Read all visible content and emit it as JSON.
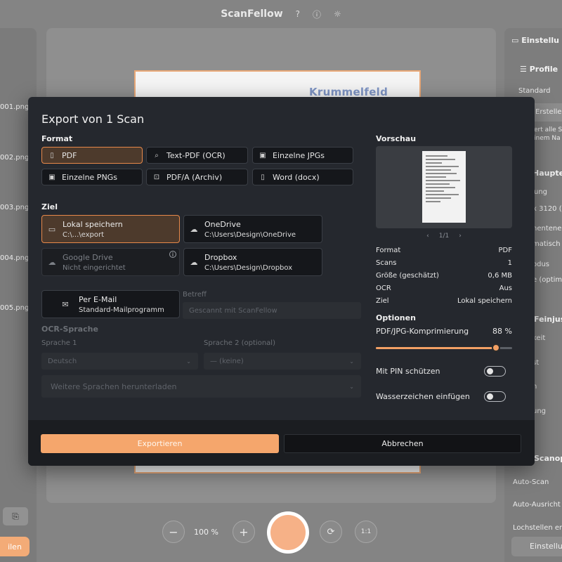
{
  "app": {
    "title": "ScanFellow",
    "files": [
      "001.png",
      "002.png",
      "003.png",
      "004.png",
      "005.png"
    ],
    "left_button_label": "ilen",
    "scan_brand": "Krummelfeld",
    "zoom": "100 %",
    "ratio_label": "1:1"
  },
  "settings_panel": {
    "title": "Einstellu",
    "profile_label": "Profile",
    "profile_value": "Standard",
    "create_label": "Erstelle",
    "desc_line1": "ert alle Sc",
    "desc_line2": "inem Na",
    "section1": "Hauptei",
    "item1": "ung",
    "resolution": "x 3120 (",
    "item3": "nentene",
    "item4": "matisch",
    "item5": "odus",
    "item6": "e (optim",
    "section2": "Feinjust",
    "item7": "keit",
    "item8": "st",
    "item9": "n",
    "item10": "ung",
    "section3": "Scanopt",
    "auto_scan": "Auto-Scan",
    "auto_align": "Auto-Ausricht",
    "holes": "Lochstellen en",
    "settings_button": "Einstellun"
  },
  "dialog": {
    "title": "Export von 1 Scan",
    "format_label": "Format",
    "formats": [
      {
        "label": "PDF",
        "icon": "file-icon",
        "selected": true
      },
      {
        "label": "Text-PDF (OCR)",
        "icon": "ocr-icon",
        "selected": false
      },
      {
        "label": "Einzelne JPGs",
        "icon": "image-icon",
        "selected": false
      },
      {
        "label": "Einzelne PNGs",
        "icon": "image-icon",
        "selected": false
      },
      {
        "label": "PDF/A (Archiv)",
        "icon": "lock-icon",
        "selected": false
      },
      {
        "label": "Word (docx)",
        "icon": "file-icon",
        "selected": false
      }
    ],
    "destination_label": "Ziel",
    "destinations": [
      {
        "title": "Lokal speichern",
        "path": "C:\\...\\export",
        "icon": "folder-icon",
        "selected": true
      },
      {
        "title": "OneDrive",
        "path": "C:\\Users\\Design\\OneDrive",
        "icon": "cloud-icon"
      },
      {
        "title": "Google Drive",
        "path": "Nicht eingerichtet",
        "icon": "cloud-icon",
        "disabled": true
      },
      {
        "title": "Dropbox",
        "path": "C:\\Users\\Design\\Dropbox",
        "icon": "cloud-icon"
      },
      {
        "title": "Per E-Mail",
        "path": "Standard-Mailprogramm",
        "icon": "mail-icon"
      }
    ],
    "subject_label": "Betreff",
    "subject_placeholder": "Gescannt mit ScanFellow",
    "ocr_label": "OCR-Sprache",
    "lang1_label": "Sprache 1",
    "lang1_value": "Deutsch",
    "lang2_label": "Sprache 2 (optional)",
    "lang2_value": "— (keine)",
    "download_langs": "Weitere Sprachen herunterladen",
    "preview_label": "Vorschau",
    "pager": "1/1",
    "info": [
      {
        "key": "Format",
        "value": "PDF"
      },
      {
        "key": "Scans",
        "value": "1"
      },
      {
        "key": "Größe (geschätzt)",
        "value": "0,6 MB"
      },
      {
        "key": "OCR",
        "value": "Aus"
      },
      {
        "key": "Ziel",
        "value": "Lokal speichern"
      }
    ],
    "options_label": "Optionen",
    "compression_label": "PDF/JPG-Komprimierung",
    "compression_value": "88 %",
    "compression_fraction": 0.88,
    "pin_label": "Mit PIN schützen",
    "pin_on": false,
    "watermark_label": "Wasserzeichen einfügen",
    "watermark_on": false,
    "export_button": "Exportieren",
    "cancel_button": "Abbrechen"
  },
  "colors": {
    "accent": "#f5a66c",
    "dialog_bg": "#25282e",
    "selected_bg": "#4d3a2c"
  }
}
